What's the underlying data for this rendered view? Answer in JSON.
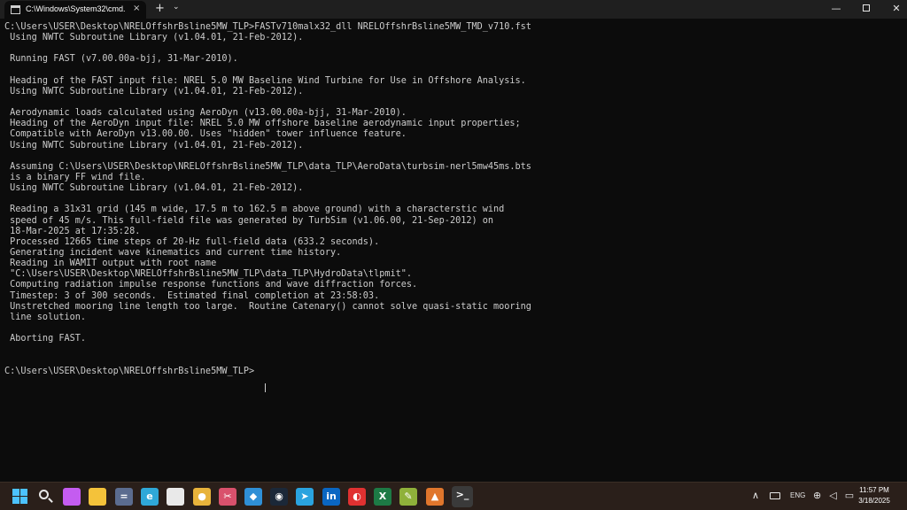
{
  "window": {
    "tab_title": "C:\\Windows\\System32\\cmd.e",
    "close_tab": "×",
    "new_tab": "+",
    "dropdown": "⌄",
    "minimize": "—",
    "close": "✕"
  },
  "console": {
    "lines": [
      "C:\\Users\\USER\\Desktop\\NRELOffshrBsline5MW_TLP>FASTv710malx32_dll NRELOffshrBsline5MW_TMD_v710.fst",
      " Using NWTC Subroutine Library (v1.04.01, 21-Feb-2012).",
      "",
      " Running FAST (v7.00.00a-bjj, 31-Mar-2010).",
      "",
      " Heading of the FAST input file: NREL 5.0 MW Baseline Wind Turbine for Use in Offshore Analysis.",
      " Using NWTC Subroutine Library (v1.04.01, 21-Feb-2012).",
      "",
      " Aerodynamic loads calculated using AeroDyn (v13.00.00a-bjj, 31-Mar-2010).",
      " Heading of the AeroDyn input file: NREL 5.0 MW offshore baseline aerodynamic input properties;",
      " Compatible with AeroDyn v13.00.00. Uses \"hidden\" tower influence feature.",
      " Using NWTC Subroutine Library (v1.04.01, 21-Feb-2012).",
      "",
      " Assuming C:\\Users\\USER\\Desktop\\NRELOffshrBsline5MW_TLP\\data_TLP\\AeroData\\turbsim-nerl5mw45ms.bts",
      " is a binary FF wind file.",
      " Using NWTC Subroutine Library (v1.04.01, 21-Feb-2012).",
      "",
      " Reading a 31x31 grid (145 m wide, 17.5 m to 162.5 m above ground) with a characterstic wind",
      " speed of 45 m/s. This full-field file was generated by TurbSim (v1.06.00, 21-Sep-2012) on",
      " 18-Mar-2025 at 17:35:28.",
      " Processed 12665 time steps of 20-Hz full-field data (633.2 seconds).",
      " Generating incident wave kinematics and current time history.",
      " Reading in WAMIT output with root name",
      " \"C:\\Users\\USER\\Desktop\\NRELOffshrBsline5MW_TLP\\data_TLP\\HydroData\\tlpmit\".",
      " Computing radiation impulse response functions and wave diffraction forces.",
      " Timestep: 3 of 300 seconds.  Estimated final completion at 23:58:03.",
      " Unstretched mooring line length too large.  Routine Catenary() cannot solve quasi-static mooring",
      " line solution.",
      "",
      " Aborting FAST.",
      "",
      "",
      "C:\\Users\\USER\\Desktop\\NRELOffshrBsline5MW_TLP>"
    ]
  },
  "taskbar": {
    "icons": [
      {
        "name": "copilot-icon",
        "color": "#c45cf0",
        "symbol": ""
      },
      {
        "name": "file-explorer-icon",
        "color": "#f4c23a",
        "symbol": ""
      },
      {
        "name": "calculator-icon",
        "color": "#5b6c8f",
        "symbol": "="
      },
      {
        "name": "edge-icon",
        "color": "#2fa8d8",
        "symbol": "e"
      },
      {
        "name": "microsoft-store-icon",
        "color": "#e9e9e9",
        "symbol": ""
      },
      {
        "name": "chrome-icon",
        "color": "#e8b33b",
        "symbol": "●"
      },
      {
        "name": "snipping-tool-icon",
        "color": "#d9516c",
        "symbol": "✂"
      },
      {
        "name": "windows-security-icon",
        "color": "#2f8fd6",
        "symbol": "◆"
      },
      {
        "name": "steam-icon",
        "color": "#1b2838",
        "symbol": "◉"
      },
      {
        "name": "telegram-icon",
        "color": "#2aa3df",
        "symbol": "➤"
      },
      {
        "name": "linkedin-icon",
        "color": "#0a66c2",
        "symbol": "in"
      },
      {
        "name": "red-app-icon",
        "color": "#e03131",
        "symbol": "◐"
      },
      {
        "name": "excel-icon",
        "color": "#1d7a45",
        "symbol": "X"
      },
      {
        "name": "notepad-plus-icon",
        "color": "#8fb13a",
        "symbol": "✎"
      },
      {
        "name": "matlab-icon",
        "color": "#e0762c",
        "symbol": "▲"
      },
      {
        "name": "terminal-icon",
        "color": "#3a3a3a",
        "symbol": ">_"
      }
    ],
    "tray": {
      "up_arrow": "∧",
      "language": "ENG",
      "system_icons": "⊕ ◁ ▭"
    },
    "clock": {
      "time": "11:57 PM",
      "date": "3/18/2025"
    }
  }
}
